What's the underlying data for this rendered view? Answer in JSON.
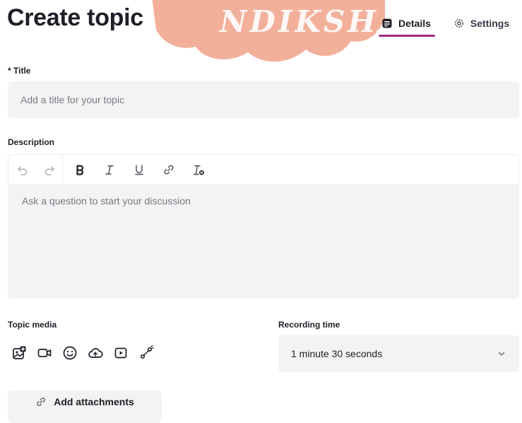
{
  "header": {
    "title": "Create topic",
    "watermark_text": "NDIKSHA",
    "tabs": [
      {
        "label": "Details",
        "icon": "details-icon",
        "active": true
      },
      {
        "label": "Settings",
        "icon": "gear-icon",
        "active": false
      }
    ]
  },
  "form": {
    "title_label": "* Title",
    "title_placeholder": "Add a title for your topic",
    "title_value": "",
    "description_label": "Description",
    "description_placeholder": "Ask a question to start your discussion",
    "description_value": "",
    "toolbar": [
      "undo-icon",
      "redo-icon",
      "bold-icon",
      "italic-icon",
      "underline-icon",
      "link-icon",
      "clear-format-icon"
    ],
    "topic_media_label": "Topic media",
    "media_icons": [
      "image-upload-icon",
      "video-icon",
      "emoji-icon",
      "cloud-upload-icon",
      "play-icon",
      "link-media-icon"
    ],
    "recording_time_label": "Recording time",
    "recording_time_value": "1 minute 30 seconds",
    "add_attachments_label": "Add attachments"
  },
  "colors": {
    "accent": "#a12b85",
    "watermark": "#f0a28a",
    "field_bg": "#f3f3f3",
    "text": "#1f1d26"
  }
}
